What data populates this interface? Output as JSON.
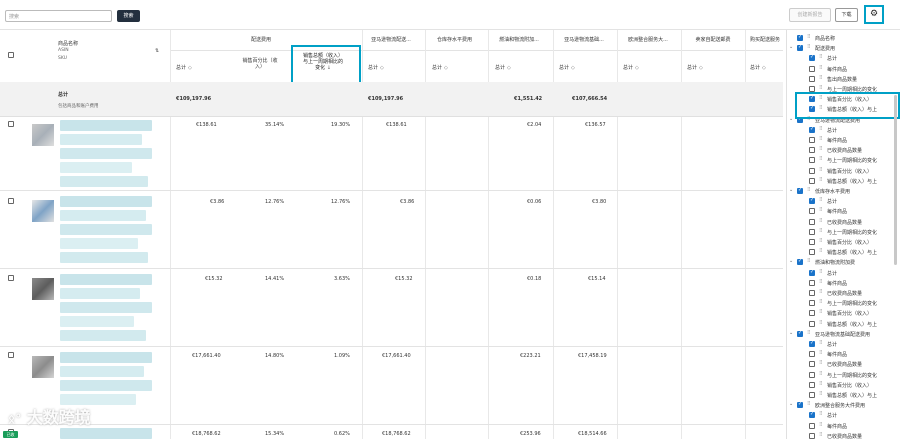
{
  "toolbar": {
    "search_placeholder": "搜索",
    "search_label": "搜索",
    "create_report_label": "创建新报告",
    "download_label": "下载",
    "gear_icon": "gear-icon"
  },
  "table": {
    "product_col": {
      "title": "商品名称",
      "line2": "ASIN",
      "line3": "SKU"
    },
    "groups": [
      "配送费用",
      "亚马逊物流配送...",
      "仓库存水平费用",
      "燃油和物流附加...",
      "亚马逊物流基础...",
      "欧洲整合服务大...",
      "卖家自配送邮费",
      "购买配送服务"
    ],
    "sub_headers": {
      "total": "总计",
      "sales_pct": "销售百分比（收入）",
      "sales_change": "销售总额（收入）与上一周期相比的变化"
    },
    "total_row": {
      "label": "总计",
      "sublabel": "包括商品和账户费用",
      "shipping_total": "€109,197.96",
      "fba_total": "€109,197.96",
      "fuel_total": "€1,551.42",
      "base_total": "€107,666.54"
    },
    "rows": [
      {
        "total": "€138.61",
        "pct": "35.14%",
        "change": "19.30%",
        "fba": "€138.61",
        "fuel": "€2.04",
        "base": "€136.57"
      },
      {
        "total": "€3.86",
        "pct": "12.76%",
        "change": "12.76%",
        "fba": "€3.86",
        "fuel": "€0.06",
        "base": "€3.80"
      },
      {
        "total": "€15.32",
        "pct": "14.41%",
        "change": "3.63%",
        "fba": "€15.32",
        "fuel": "€0.18",
        "base": "€15.14"
      },
      {
        "total": "€17,661.40",
        "pct": "14.80%",
        "change": "1.09%",
        "fba": "€17,661.40",
        "fuel": "€223.21",
        "base": "€17,458.19"
      },
      {
        "total": "€18,768.62",
        "pct": "15.34%",
        "change": "0.62%",
        "fba": "€18,768.62",
        "fuel": "€253.96",
        "base": "€18,514.66"
      }
    ]
  },
  "panel": {
    "items": [
      {
        "label": "商品名称",
        "checked": true,
        "level": 0,
        "caret": false
      },
      {
        "label": "配送费用",
        "checked": true,
        "level": 0,
        "caret": true
      },
      {
        "label": "总计",
        "checked": true,
        "level": 1
      },
      {
        "label": "每件商品",
        "checked": false,
        "level": 1
      },
      {
        "label": "售出商品数量",
        "checked": false,
        "level": 1
      },
      {
        "label": "与上一周期相比的变化",
        "checked": false,
        "level": 1
      },
      {
        "label": "销售百分比（收入）",
        "checked": true,
        "level": 1
      },
      {
        "label": "销售总额（收入）与上",
        "checked": true,
        "level": 1
      },
      {
        "label": "亚马逊物流配送费用",
        "checked": true,
        "level": 0,
        "caret": true
      },
      {
        "label": "总计",
        "checked": true,
        "level": 1
      },
      {
        "label": "每件商品",
        "checked": false,
        "level": 1
      },
      {
        "label": "已收费商品数量",
        "checked": false,
        "level": 1
      },
      {
        "label": "与上一周期相比的变化",
        "checked": false,
        "level": 1
      },
      {
        "label": "销售百分比（收入）",
        "checked": false,
        "level": 1
      },
      {
        "label": "销售总额（收入）与上",
        "checked": false,
        "level": 1
      },
      {
        "label": "低库存水平费用",
        "checked": true,
        "level": 0,
        "caret": true
      },
      {
        "label": "总计",
        "checked": true,
        "level": 1
      },
      {
        "label": "每件商品",
        "checked": false,
        "level": 1
      },
      {
        "label": "已收费商品数量",
        "checked": false,
        "level": 1
      },
      {
        "label": "与上一周期相比的变化",
        "checked": false,
        "level": 1
      },
      {
        "label": "销售百分比（收入）",
        "checked": false,
        "level": 1
      },
      {
        "label": "销售总额（收入）与上",
        "checked": false,
        "level": 1
      },
      {
        "label": "燃油和物流附加费",
        "checked": true,
        "level": 0,
        "caret": true
      },
      {
        "label": "总计",
        "checked": true,
        "level": 1
      },
      {
        "label": "每件商品",
        "checked": false,
        "level": 1
      },
      {
        "label": "已收费商品数量",
        "checked": false,
        "level": 1
      },
      {
        "label": "与上一周期相比的变化",
        "checked": false,
        "level": 1
      },
      {
        "label": "销售百分比（收入）",
        "checked": false,
        "level": 1
      },
      {
        "label": "销售总额（收入）与上",
        "checked": false,
        "level": 1
      },
      {
        "label": "亚马逊物流基础配送费用",
        "checked": true,
        "level": 0,
        "caret": true
      },
      {
        "label": "总计",
        "checked": true,
        "level": 1
      },
      {
        "label": "每件商品",
        "checked": false,
        "level": 1
      },
      {
        "label": "已收费商品数量",
        "checked": false,
        "level": 1
      },
      {
        "label": "与上一周期相比的变化",
        "checked": false,
        "level": 1
      },
      {
        "label": "销售百分比（收入）",
        "checked": false,
        "level": 1
      },
      {
        "label": "销售总额（收入）与上",
        "checked": false,
        "level": 1
      },
      {
        "label": "欧洲整合服务大件费用",
        "checked": true,
        "level": 0,
        "caret": true
      },
      {
        "label": "总计",
        "checked": true,
        "level": 1
      },
      {
        "label": "每件商品",
        "checked": false,
        "level": 1
      },
      {
        "label": "已收费商品数量",
        "checked": false,
        "level": 1
      }
    ]
  },
  "watermark": {
    "text": "大数跨境",
    "badge": "已收"
  }
}
